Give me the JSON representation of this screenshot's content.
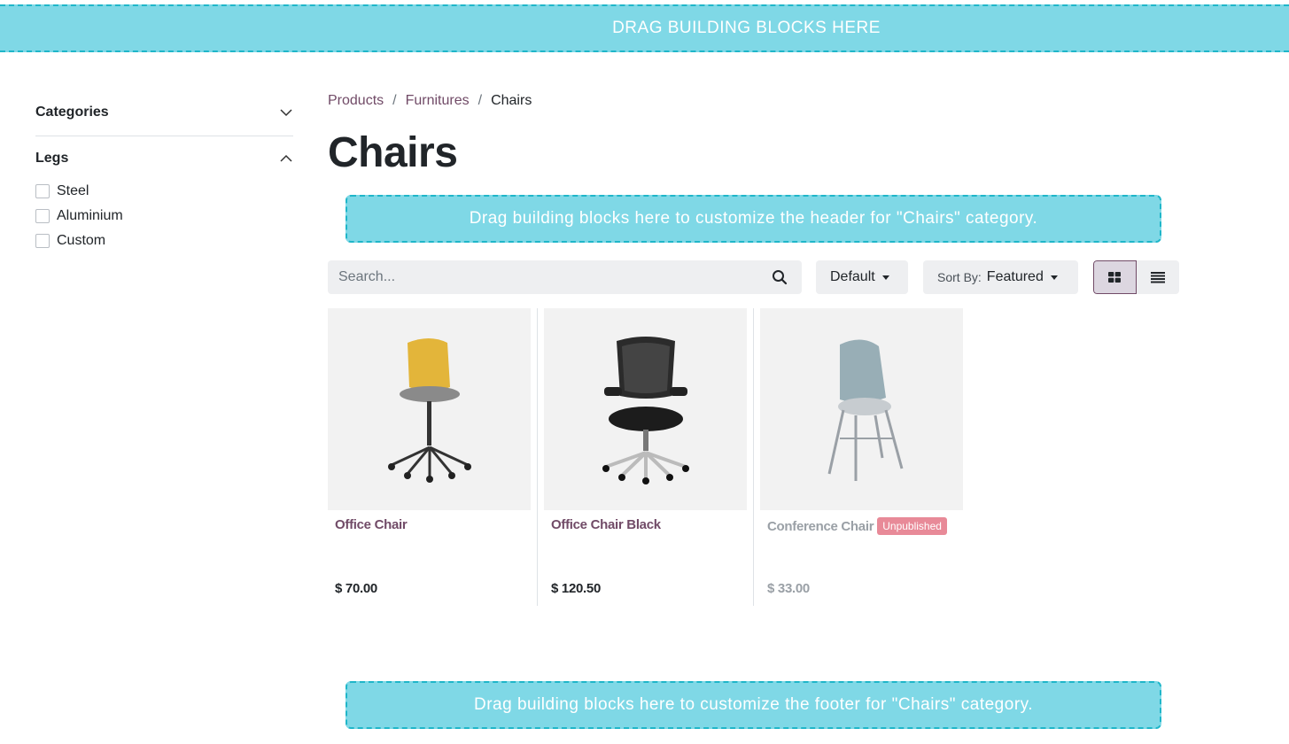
{
  "top_dropzone": {
    "text": "DRAG BUILDING BLOCKS HERE"
  },
  "sidebar": {
    "categories_label": "Categories",
    "legs_label": "Legs",
    "legs_options": [
      "Steel",
      "Aluminium",
      "Custom"
    ]
  },
  "breadcrumb": {
    "items": [
      "Products",
      "Furnitures",
      "Chairs"
    ],
    "separator": "/"
  },
  "page_title": "Chairs",
  "header_dropzone": {
    "text": "Drag building blocks here to customize the header for \"Chairs\" category."
  },
  "footer_dropzone": {
    "text": "Drag building blocks here to customize the footer for \"Chairs\" category."
  },
  "toolbar": {
    "search_placeholder": "Search...",
    "pricelist_label": "Default",
    "sort_prefix": "Sort By:",
    "sort_value": "Featured"
  },
  "products": [
    {
      "name": "Office Chair",
      "price": "$ 70.00",
      "badge": "",
      "image": "yellow-office-chair"
    },
    {
      "name": "Office Chair Black",
      "price": "$ 120.50",
      "badge": "",
      "image": "black-office-chair"
    },
    {
      "name": "Conference Chair",
      "price": "$ 33.00",
      "badge": "Unpublished",
      "image": "grey-conference-chair"
    }
  ],
  "colors": {
    "accent": "#714b67",
    "dropzone_bg": "#7fd8e6",
    "dropzone_border": "#1fb6c9",
    "badge_bg": "#e88a98"
  }
}
